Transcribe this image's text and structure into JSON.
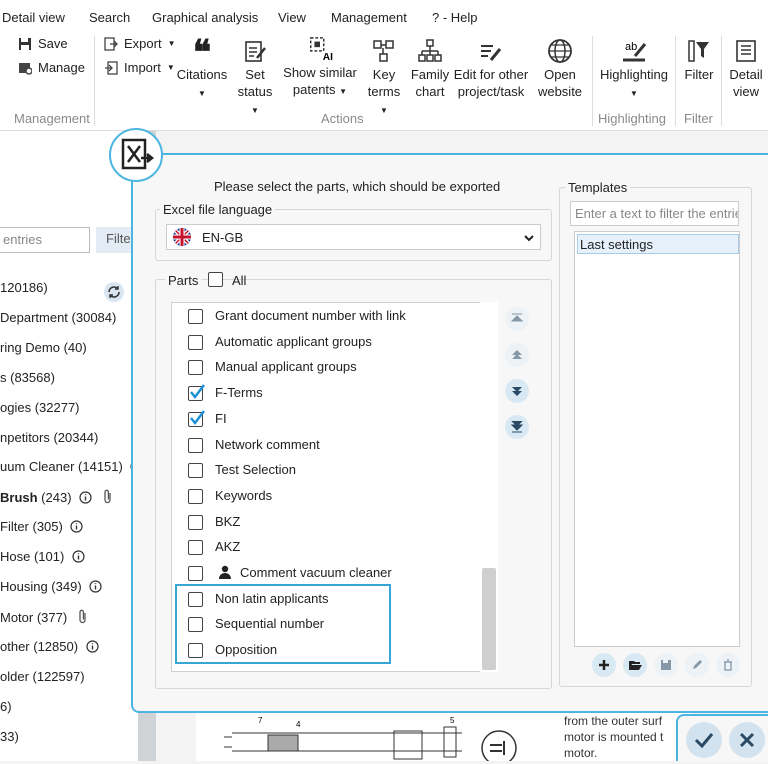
{
  "menu": [
    "Detail view",
    "Search",
    "Graphical analysis",
    "View",
    "Management",
    "? - Help"
  ],
  "ribbon": {
    "management": {
      "save": "Save",
      "manage": "Manage",
      "label": "Management"
    },
    "export": "Export",
    "import": "Import",
    "actions": [
      {
        "line1": "Citations",
        "line2": "",
        "dropdown": true
      },
      {
        "line1": "Set",
        "line2": "status",
        "dropdown": true
      },
      {
        "line1": "Show similar",
        "line2": "patents",
        "dropdown": true
      },
      {
        "line1": "Key",
        "line2": "terms",
        "dropdown": true
      },
      {
        "line1": "Family",
        "line2": "chart",
        "dropdown": false
      },
      {
        "line1": "Edit for other",
        "line2": "project/task",
        "dropdown": false
      },
      {
        "line1": "Open",
        "line2": "website",
        "dropdown": false
      }
    ],
    "actions_label": "Actions",
    "highlighting": "Highlighting",
    "highlighting_label": "Highlighting",
    "filter": "Filter",
    "filter_label": "Filter",
    "detail": {
      "line1": "Detail",
      "line2": "view"
    },
    "ai_badge": "AI",
    "ab_badge": "ab"
  },
  "left": {
    "search_placeholder": "entries",
    "filter_button": "Filte",
    "items": [
      {
        "text": "120186)",
        "bold": "",
        "info": false,
        "clip": false
      },
      {
        "text": " Department (30084)",
        "bold": "",
        "info": false,
        "clip": false
      },
      {
        "text": "ring Demo (40)",
        "bold": "",
        "info": false,
        "clip": false
      },
      {
        "text": "s (83568)",
        "bold": "",
        "info": false,
        "clip": false
      },
      {
        "text": "ogies (32277)",
        "bold": "",
        "info": false,
        "clip": false
      },
      {
        "text": "npetitors (20344)",
        "bold": "",
        "info": false,
        "clip": false
      },
      {
        "text": "uum Cleaner (14151)",
        "bold": "",
        "info": true,
        "clip": false
      },
      {
        "text": " (243)",
        "bold": "Brush",
        "info": true,
        "clip": true
      },
      {
        "text": "Filter (305)",
        "bold": "",
        "info": true,
        "clip": false
      },
      {
        "text": "Hose (101)",
        "bold": "",
        "info": true,
        "clip": false
      },
      {
        "text": "Housing (349)",
        "bold": "",
        "info": true,
        "clip": false
      },
      {
        "text": "Motor (377)",
        "bold": "",
        "info": false,
        "clip": true
      },
      {
        "text": "other (12850)",
        "bold": "",
        "info": true,
        "clip": false
      },
      {
        "text": "older (122597)",
        "bold": "",
        "info": false,
        "clip": false
      },
      {
        "text": "6)",
        "bold": "",
        "info": false,
        "clip": false
      },
      {
        "text": "33)",
        "bold": "",
        "info": false,
        "clip": false
      }
    ]
  },
  "dialog": {
    "title": "Please select the parts, which should be exported",
    "excel_language_label": "Excel file language",
    "language": "EN-GB",
    "parts_label": "Parts",
    "all_label": "All",
    "parts": [
      {
        "label": "Grant document number with link",
        "checked": false,
        "person": false
      },
      {
        "label": "Automatic applicant groups",
        "checked": false,
        "person": false
      },
      {
        "label": "Manual applicant groups",
        "checked": false,
        "person": false
      },
      {
        "label": "F-Terms",
        "checked": true,
        "person": false
      },
      {
        "label": "FI",
        "checked": true,
        "person": false
      },
      {
        "label": "Network comment",
        "checked": false,
        "person": false
      },
      {
        "label": "Test Selection",
        "checked": false,
        "person": false
      },
      {
        "label": "Keywords",
        "checked": false,
        "person": false
      },
      {
        "label": "BKZ",
        "checked": false,
        "person": false
      },
      {
        "label": "AKZ",
        "checked": false,
        "person": false
      },
      {
        "label": "Comment vacuum cleaner",
        "checked": false,
        "person": true
      },
      {
        "label": "Non latin applicants",
        "checked": false,
        "person": false
      },
      {
        "label": "Sequential number",
        "checked": false,
        "person": false
      },
      {
        "label": "Opposition",
        "checked": false,
        "person": false
      }
    ],
    "templates_label": "Templates",
    "template_filter_placeholder": "Enter a text to filter the entries",
    "templates": [
      "Last settings"
    ]
  },
  "background_text": [
    "from the outer surf",
    "motor is mounted t",
    "motor."
  ],
  "drawing_labels": [
    "7",
    "4",
    "5"
  ],
  "colors": {
    "accent": "#4cb4e0",
    "check": "#1e90d6",
    "action_button": "#d2e2ee"
  }
}
